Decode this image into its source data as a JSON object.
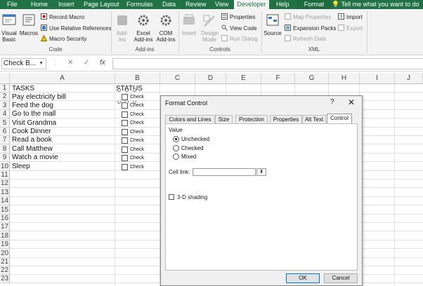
{
  "ribbon_tabs": [
    "File",
    "Home",
    "Insert",
    "Page Layout",
    "Formulas",
    "Data",
    "Review",
    "View",
    "Developer",
    "Help",
    "Format"
  ],
  "active_tab": "Developer",
  "tell_me": "Tell me what you want to do",
  "tell_me_icon": "lightbulb-icon",
  "colors": {
    "ribbon_green": "#217346",
    "ribbon_bg": "#f3f3f3",
    "ok_border": "#0078d7"
  },
  "code_group": {
    "label": "Code",
    "visual_basic": "Visual Basic",
    "macros": "Macros",
    "record_macro": "Record Macro",
    "relative_references": "Use Relative References",
    "macro_security": "Macro Security"
  },
  "addins_group": {
    "label": "Add-ins",
    "addins": "Add-ins",
    "excel_addins": "Excel Add-ins",
    "com_addins": "COM Add-ins"
  },
  "controls_group": {
    "label": "Controls",
    "insert": "Insert",
    "design_mode": "Design Mode",
    "properties": "Properties",
    "view_code": "View Code",
    "run_dialog": "Run Dialog"
  },
  "xml_group": {
    "label": "XML",
    "source": "Source",
    "map_properties": "Map Properties",
    "expansion_packs": "Expansion Packs",
    "refresh_data": "Refresh Data",
    "import": "Import",
    "export": "Export"
  },
  "formula_bar": {
    "name_box": "Check B...",
    "cancel_glyph": "✕",
    "enter_glyph": "✓",
    "fx": "fx",
    "formula": ""
  },
  "columns": [
    "A",
    "B",
    "C",
    "D",
    "E",
    "F",
    "G",
    "H",
    "I",
    "J"
  ],
  "rows": [
    "1",
    "2",
    "3",
    "4",
    "5",
    "6",
    "7",
    "8",
    "9",
    "10",
    "11",
    "12",
    "13",
    "14",
    "15",
    "16",
    "17",
    "18",
    "19",
    "20",
    "21",
    "22",
    "23"
  ],
  "cells": {
    "A1": "TASKS",
    "B1": "STATUS",
    "tasks": [
      "Pay electricity bill",
      "Feed the dog",
      "Go to the mall",
      "Visit Grandma",
      "Cook Dinner",
      "Read a book",
      "Call Matthew",
      "Watch a movie",
      "Sleep"
    ]
  },
  "checkbox_label": "Check",
  "dialog": {
    "title": "Format Control",
    "help": "?",
    "close": "✕",
    "tabs": [
      "Colors and Lines",
      "Size",
      "Protection",
      "Properties",
      "Alt Text",
      "Control"
    ],
    "active_tab": "Control",
    "value_label": "Value",
    "options": [
      "Unchecked",
      "Checked",
      "Mixed"
    ],
    "selected_option": "Unchecked",
    "cell_link_label": "Cell link:",
    "cell_link_value": "",
    "shading_label": "3-D shading",
    "shading_checked": false,
    "ok": "OK",
    "cancel": "Cancel"
  }
}
